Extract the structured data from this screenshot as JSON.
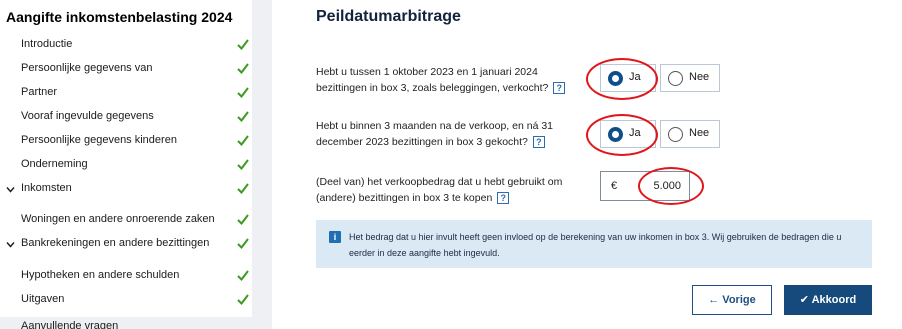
{
  "sidebar": {
    "title": "Aangifte inkomstenbelasting 2024",
    "items": [
      {
        "label": "Introductie",
        "done": true
      },
      {
        "label": "Persoonlijke gegevens van",
        "done": true
      },
      {
        "label": "Partner",
        "done": true
      },
      {
        "label": "Vooraf ingevulde gegevens",
        "done": true
      },
      {
        "label": "Persoonlijke gegevens kinderen",
        "done": true
      },
      {
        "label": "Onderneming",
        "done": true
      },
      {
        "label": "Inkomsten",
        "done": true,
        "expanded": true
      },
      {
        "label": "Woningen en andere onroerende zaken",
        "done": true
      },
      {
        "label": "Bankrekeningen en andere bezittingen",
        "done": true,
        "expanded": true
      },
      {
        "label": "Hypotheken en andere schulden",
        "done": true
      },
      {
        "label": "Uitgaven",
        "done": true
      },
      {
        "label": "Aanvullende vragen",
        "done": false
      }
    ]
  },
  "main": {
    "title": "Peildatumarbitrage",
    "questions": [
      {
        "text": "Hebt u tussen 1 oktober 2023 en 1 januari 2024 bezittingen in box 3, zoals beleggingen, verkocht?",
        "help": "?",
        "options": [
          "Ja",
          "Nee"
        ],
        "selected": "Ja"
      },
      {
        "text": "Hebt u binnen 3 maanden na de verkoop, en ná 31 december 2023 bezittingen in box 3 gekocht?",
        "help": "?",
        "options": [
          "Ja",
          "Nee"
        ],
        "selected": "Ja"
      },
      {
        "text": "(Deel van) het verkoopbedrag dat u hebt gebruikt om (andere) bezittingen in box 3 te kopen",
        "help": "?",
        "currency": "€",
        "value": "5.000"
      }
    ],
    "info": {
      "icon": "info-icon",
      "text": "Het bedrag dat u hier invult heeft geen invloed op de berekening van uw inkomen in box 3. Wij gebruiken de bedragen die u eerder in deze aangifte hebt ingevuld."
    },
    "buttons": {
      "prev": "← Vorige",
      "ok": "✔ Akkoord"
    }
  },
  "colors": {
    "accent": "#174a7c",
    "check": "#3a9a1e",
    "annotation": "#e0161b",
    "info_bg": "#dbe9f5"
  }
}
